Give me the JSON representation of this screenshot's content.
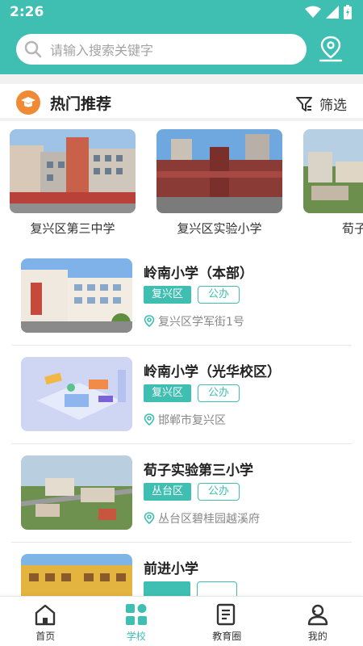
{
  "status_bar": {
    "time": "2:26"
  },
  "search": {
    "placeholder": "请输入搜索关键字"
  },
  "hot_section": {
    "title": "热门推荐",
    "filter_label": "筛选"
  },
  "featured": [
    {
      "name": "复兴区第三中学"
    },
    {
      "name": "复兴区实验小学"
    },
    {
      "name": "荀子实验"
    }
  ],
  "schools": [
    {
      "name": "岭南小学（本部）",
      "district": "复兴区",
      "type": "公办",
      "address": "复兴区学军街1号"
    },
    {
      "name": "岭南小学（光华校区）",
      "district": "复兴区",
      "type": "公办",
      "address": "邯郸市复兴区"
    },
    {
      "name": "荀子实验第三小学",
      "district": "丛台区",
      "type": "公办",
      "address": "丛台区碧桂园越溪府"
    },
    {
      "name": "前进小学",
      "district": "",
      "type": "",
      "address": ""
    }
  ],
  "tabbar": [
    {
      "label": "首页",
      "icon": "home-icon"
    },
    {
      "label": "学校",
      "icon": "school-icon"
    },
    {
      "label": "教育圈",
      "icon": "news-icon"
    },
    {
      "label": "我的",
      "icon": "profile-icon"
    }
  ],
  "colors": {
    "accent": "#3fbfb2",
    "hot_icon": "#f08a34"
  }
}
